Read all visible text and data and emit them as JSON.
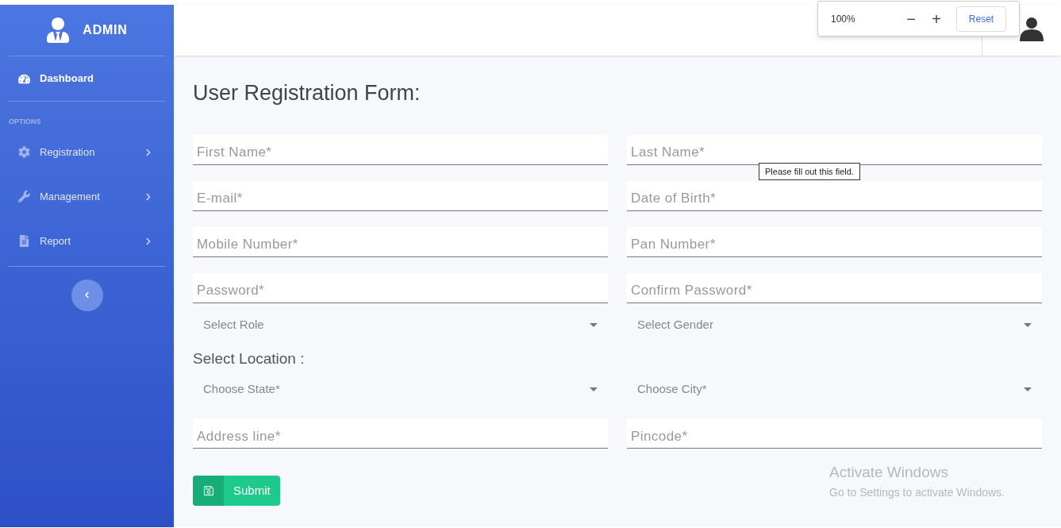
{
  "sidebar": {
    "brand": "ADMIN",
    "top_items": [
      {
        "label": "Dashboard",
        "selected": true
      }
    ],
    "section": "OPTIONS",
    "menu_items": [
      {
        "label": "Registration",
        "selected": false
      },
      {
        "label": "Management",
        "selected": false
      },
      {
        "label": "Report",
        "selected": false
      }
    ]
  },
  "zoom_popup": {
    "value": "100%",
    "decrease": "−",
    "increase": "+",
    "reset": "Reset"
  },
  "form": {
    "title": "User Registration Form:",
    "items": [
      {
        "kind": "input",
        "placeholder": "First Name*"
      },
      {
        "kind": "input",
        "placeholder": "Last Name*"
      },
      {
        "kind": "input",
        "placeholder": "E-mail*"
      },
      {
        "kind": "input",
        "placeholder": "Date of Birth*"
      },
      {
        "kind": "input",
        "placeholder": "Mobile Number*"
      },
      {
        "kind": "input",
        "placeholder": "Pan Number*"
      },
      {
        "kind": "input",
        "placeholder": "Password*"
      },
      {
        "kind": "input",
        "placeholder": "Confirm Password*"
      },
      {
        "kind": "select",
        "placeholder": "Select Role"
      },
      {
        "kind": "select",
        "placeholder": "Select Gender"
      },
      {
        "kind": "heading",
        "text": "Select Location :"
      },
      {
        "kind": "select",
        "placeholder": "Choose State*"
      },
      {
        "kind": "select",
        "placeholder": "Choose City*"
      },
      {
        "kind": "input",
        "placeholder": "Address line*"
      },
      {
        "kind": "input",
        "placeholder": "Pincode*"
      }
    ],
    "tooltip": "Please fill out this field.",
    "submit": "Submit"
  },
  "os_notice": {
    "title": "Activate Windows",
    "text": "Go to Settings to activate Windows."
  }
}
